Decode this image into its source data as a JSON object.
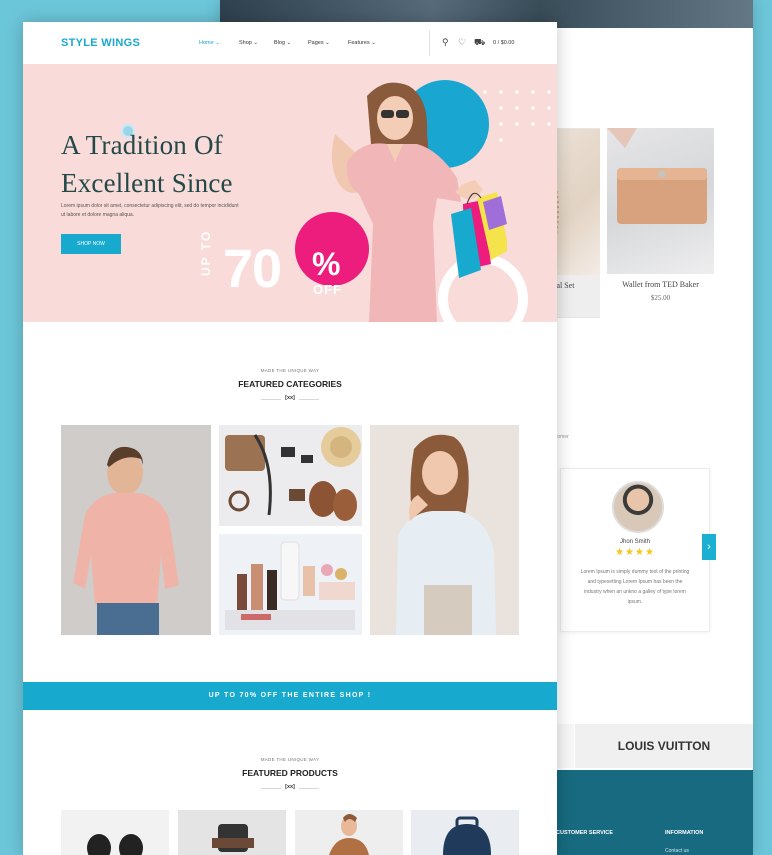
{
  "back_page": {
    "products": [
      {
        "name": "ital Set",
        "price": ""
      },
      {
        "name": "Wallet from TED Baker",
        "price": "$25.00"
      }
    ],
    "label_small": "tomer",
    "testimonial": {
      "name": "Jhon Smith",
      "stars": "★★★★",
      "text": "Lorem Ipsum is simply dummy text of the printing and typesetting Lorem Ipsum has been the industry when an unkno a galley of type lorem ipsum."
    },
    "arrow": "›",
    "brand": "LOUIS VUITTON",
    "footer": {
      "col1_title": "CUSTOMER SERVICE",
      "col2_title": "INFORMATION",
      "col2_link": "Contact us"
    }
  },
  "nav": {
    "logo": "STYLE WINGS",
    "menu": [
      "Home",
      "Shop",
      "Blog",
      "Pages",
      "Features"
    ],
    "cart": "0 / $0.00"
  },
  "hero": {
    "title_line1": "A Tradition Of",
    "title_line2": "Excellent Since",
    "subtitle": "Lorem ipsum dolor sit amet, consectetur adipiscing elit, sed do tempor incididunt ut labore et dolore magna aliqua.",
    "button": "SHOP NOW",
    "promo_up_to": "UP TO",
    "promo_value": "70",
    "promo_percent": "%",
    "promo_off": "OFF"
  },
  "categories": {
    "eyebrow": "MADE THE UNIQUE WAY",
    "title": "FEATURED CATEGORIES",
    "mark": "[xx]"
  },
  "banner": "UP TO 70% OFF THE ENTIRE SHOP !",
  "products": {
    "eyebrow": "MADE THE UNIQUE WAY",
    "title": "FEATURED PRODUCTS",
    "mark": "[xx]"
  },
  "colors": {
    "accent": "#18a9cf",
    "hero_bg": "#f9dcd9",
    "pink": "#ec1d7c",
    "heading": "#234848"
  }
}
